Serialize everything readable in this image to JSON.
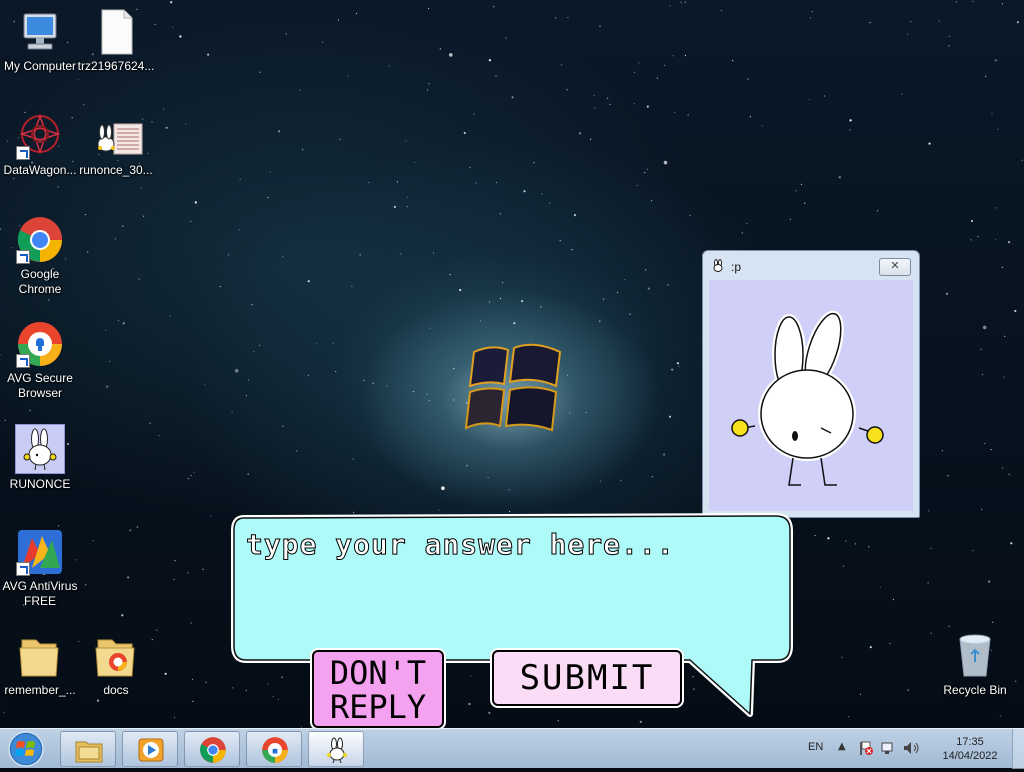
{
  "desktop": {
    "icons": [
      {
        "label": "My Computer",
        "icon": "computer-icon"
      },
      {
        "label": "trz21967624...",
        "icon": "file-icon"
      },
      {
        "label": "DataWagon...",
        "icon": "datawagon-icon"
      },
      {
        "label": "runonce_30...",
        "icon": "runonce-file-icon"
      },
      {
        "label": "Google Chrome",
        "icon": "chrome-icon"
      },
      {
        "label": "AVG Secure Browser",
        "icon": "avg-browser-icon"
      },
      {
        "label": "RUNONCE",
        "icon": "runonce-bunny-icon"
      },
      {
        "label": "AVG AntiVirus FREE",
        "icon": "avg-antivirus-icon"
      },
      {
        "label": "remember_...",
        "icon": "folder-icon"
      },
      {
        "label": "docs",
        "icon": "folder-icon"
      },
      {
        "label": "Recycle Bin",
        "icon": "recycle-bin-icon"
      }
    ]
  },
  "bunny_window": {
    "title": ":p",
    "close_label": "✕"
  },
  "dialog": {
    "placeholder": "type your answer here...",
    "answer_value": "",
    "dont_reply_line1": "DON'T",
    "dont_reply_line2": "REPLY",
    "submit_label": "SUBMIT",
    "bubble_color": "#aefaf8",
    "dont_reply_color": "#f4a2f0",
    "submit_color": "#fbdcf6"
  },
  "taskbar": {
    "pinned": [
      "file-explorer-icon",
      "media-player-icon",
      "chrome-icon",
      "avg-browser-icon",
      "runonce-bunny-icon"
    ],
    "active": "runonce-bunny-icon",
    "language": "EN",
    "time": "17:35",
    "date": "14/04/2022"
  }
}
